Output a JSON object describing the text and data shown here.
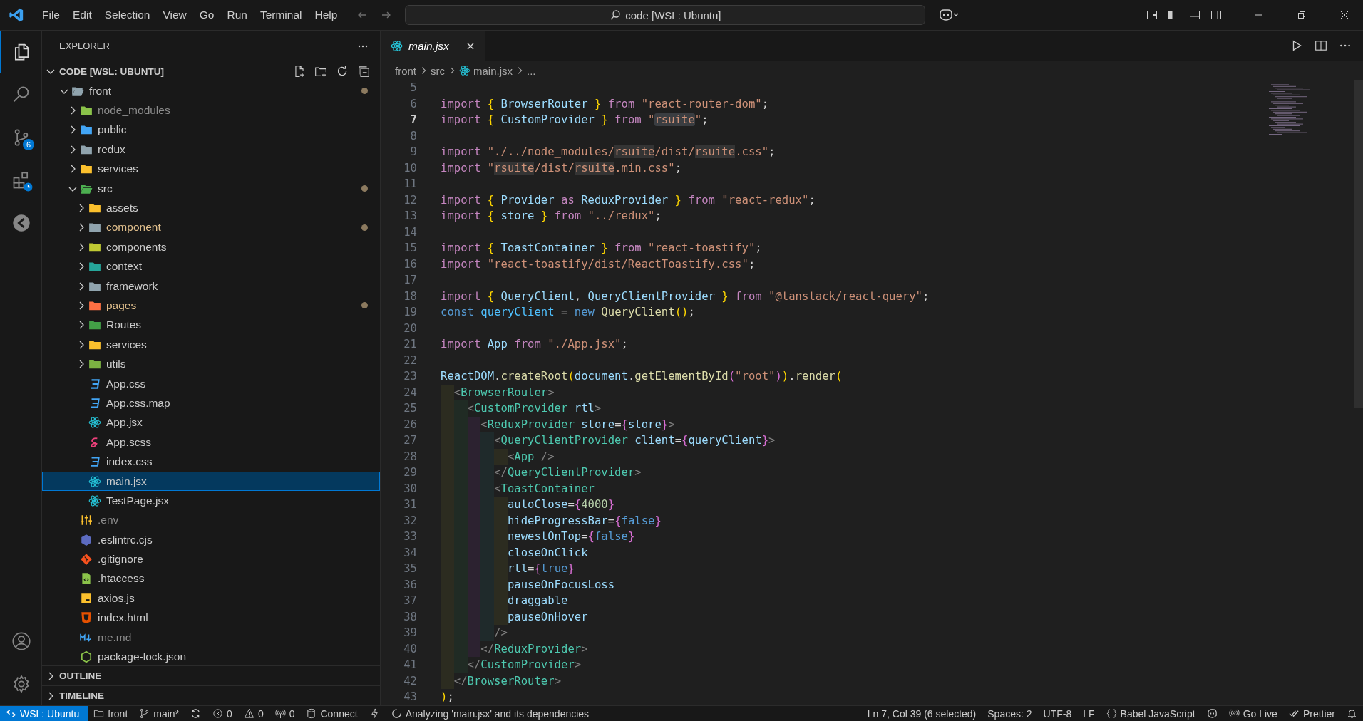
{
  "title_bar": {
    "menu": [
      "File",
      "Edit",
      "Selection",
      "View",
      "Go",
      "Run",
      "Terminal",
      "Help"
    ],
    "command_center": "code [WSL: Ubuntu]"
  },
  "activity_bar": {
    "items": [
      {
        "kind": "explorer",
        "selected": true
      },
      {
        "kind": "search",
        "selected": false
      },
      {
        "kind": "source-control",
        "selected": false,
        "badge": "6"
      },
      {
        "kind": "extensions",
        "selected": false
      },
      {
        "kind": "remote",
        "selected": false
      }
    ],
    "bottom": [
      {
        "kind": "account"
      },
      {
        "kind": "settings"
      }
    ]
  },
  "sidebar": {
    "title": "EXPLORER",
    "section": {
      "title": "CODE [WSL: UBUNTU]",
      "expanded": true
    },
    "tree": [
      {
        "name": "front",
        "kind": "folder",
        "color": "#90a4ae",
        "expanded": true,
        "selected": false,
        "has_changes": true,
        "children": [
          {
            "name": "node_modules",
            "kind": "folder",
            "color": "#8bc34a",
            "expanded": false,
            "selected": false,
            "ignored": true
          },
          {
            "name": "public",
            "kind": "folder",
            "color": "#42a5f5",
            "expanded": false,
            "selected": false
          },
          {
            "name": "redux",
            "kind": "folder",
            "color": "#90a4ae",
            "expanded": false,
            "selected": false
          },
          {
            "name": "services",
            "kind": "folder",
            "color": "#fbc02d",
            "expanded": false,
            "selected": false
          },
          {
            "name": "src",
            "kind": "folder",
            "color": "#4caf50",
            "expanded": true,
            "selected": false,
            "has_changes": true,
            "children": [
              {
                "name": "assets",
                "kind": "folder",
                "color": "#fbc02d",
                "expanded": false,
                "selected": false
              },
              {
                "name": "component",
                "kind": "folder",
                "color": "#90a4ae",
                "expanded": false,
                "selected": false,
                "has_changes": true,
                "modified": true
              },
              {
                "name": "components",
                "kind": "folder",
                "color": "#c0ca33",
                "expanded": false,
                "selected": false
              },
              {
                "name": "context",
                "kind": "folder",
                "color": "#26a69a",
                "expanded": false,
                "selected": false
              },
              {
                "name": "framework",
                "kind": "folder",
                "color": "#90a4ae",
                "expanded": false,
                "selected": false
              },
              {
                "name": "pages",
                "kind": "folder",
                "color": "#ff7043",
                "expanded": false,
                "selected": false,
                "has_changes": true,
                "modified": true
              },
              {
                "name": "Routes",
                "kind": "folder",
                "color": "#43a047",
                "expanded": false,
                "selected": false
              },
              {
                "name": "services",
                "kind": "folder",
                "color": "#fbc02d",
                "expanded": false,
                "selected": false
              },
              {
                "name": "utils",
                "kind": "folder",
                "color": "#7cb342",
                "expanded": false,
                "selected": false
              },
              {
                "name": "App.css",
                "kind": "css",
                "selected": false
              },
              {
                "name": "App.css.map",
                "kind": "css",
                "selected": false
              },
              {
                "name": "App.jsx",
                "kind": "react",
                "selected": false
              },
              {
                "name": "App.scss",
                "kind": "sass",
                "selected": false
              },
              {
                "name": "index.css",
                "kind": "css",
                "selected": false
              },
              {
                "name": "main.jsx",
                "kind": "react",
                "selected": true
              },
              {
                "name": "TestPage.jsx",
                "kind": "react",
                "selected": false
              }
            ]
          },
          {
            "name": ".env",
            "kind": "env",
            "selected": false,
            "ignored": true
          },
          {
            "name": ".eslintrc.cjs",
            "kind": "eslint",
            "selected": false
          },
          {
            "name": ".gitignore",
            "kind": "git",
            "selected": false
          },
          {
            "name": ".htaccess",
            "kind": "htaccess",
            "selected": false
          },
          {
            "name": "axios.js",
            "kind": "js",
            "selected": false
          },
          {
            "name": "index.html",
            "kind": "html",
            "selected": false
          },
          {
            "name": "me.md",
            "kind": "markdown",
            "selected": false,
            "ignored": true
          },
          {
            "name": "package-lock.json",
            "kind": "json",
            "selected": false
          }
        ]
      }
    ],
    "panels": [
      {
        "title": "OUTLINE",
        "expanded": false
      },
      {
        "title": "TIMELINE",
        "expanded": false
      }
    ]
  },
  "editor": {
    "tabs": [
      {
        "label": "main.jsx",
        "kind": "react",
        "selected": true,
        "preview": true
      }
    ],
    "breadcrumbs": [
      {
        "text": "front"
      },
      {
        "text": "src"
      },
      {
        "text": "main.jsx",
        "kind": "react"
      },
      {
        "text": "..."
      }
    ],
    "lines": [
      {
        "n": "5",
        "current": false
      },
      {
        "n": "6",
        "current": false,
        "tokens": [
          {
            "kind": "kw",
            "text": "import "
          },
          {
            "kind": "br",
            "text": "{ "
          },
          {
            "kind": "id",
            "text": "BrowserRouter "
          },
          {
            "kind": "br",
            "text": "} "
          },
          {
            "kind": "kw",
            "text": "from "
          },
          {
            "kind": "str",
            "text": "\"react-router-dom\""
          },
          {
            "kind": "pl",
            "text": ";"
          }
        ]
      },
      {
        "n": "7",
        "current": true,
        "tokens": [
          {
            "kind": "kw",
            "text": "import "
          },
          {
            "kind": "br",
            "text": "{ "
          },
          {
            "kind": "id",
            "text": "CustomProvider "
          },
          {
            "kind": "br",
            "text": "} "
          },
          {
            "kind": "kw",
            "text": "from "
          },
          {
            "kind": "str",
            "text": "\""
          },
          {
            "kind": "strsel",
            "text": "rsuite"
          },
          {
            "kind": "str",
            "text": "\""
          },
          {
            "kind": "pl",
            "text": ";"
          }
        ]
      },
      {
        "n": "8",
        "current": false
      },
      {
        "n": "9",
        "current": false,
        "tokens": [
          {
            "kind": "kw",
            "text": "import "
          },
          {
            "kind": "str",
            "text": "\"./../node_modules/"
          },
          {
            "kind": "strhl",
            "text": "rsuite"
          },
          {
            "kind": "str",
            "text": "/dist/"
          },
          {
            "kind": "strhl",
            "text": "rsuite"
          },
          {
            "kind": "str",
            "text": ".css\""
          },
          {
            "kind": "pl",
            "text": ";"
          }
        ]
      },
      {
        "n": "10",
        "current": false,
        "tokens": [
          {
            "kind": "kw",
            "text": "import "
          },
          {
            "kind": "str",
            "text": "\""
          },
          {
            "kind": "strhl",
            "text": "rsuite"
          },
          {
            "kind": "str",
            "text": "/dist/"
          },
          {
            "kind": "strhl",
            "text": "rsuite"
          },
          {
            "kind": "str",
            "text": ".min.css\""
          },
          {
            "kind": "pl",
            "text": ";"
          }
        ]
      },
      {
        "n": "11",
        "current": false
      },
      {
        "n": "12",
        "current": false,
        "tokens": [
          {
            "kind": "kw",
            "text": "import "
          },
          {
            "kind": "br",
            "text": "{ "
          },
          {
            "kind": "id",
            "text": "Provider "
          },
          {
            "kind": "kw",
            "text": "as "
          },
          {
            "kind": "id",
            "text": "ReduxProvider "
          },
          {
            "kind": "br",
            "text": "} "
          },
          {
            "kind": "kw",
            "text": "from "
          },
          {
            "kind": "str",
            "text": "\"react-redux\""
          },
          {
            "kind": "pl",
            "text": ";"
          }
        ]
      },
      {
        "n": "13",
        "current": false,
        "tokens": [
          {
            "kind": "kw",
            "text": "import "
          },
          {
            "kind": "br",
            "text": "{ "
          },
          {
            "kind": "id",
            "text": "store "
          },
          {
            "kind": "br",
            "text": "} "
          },
          {
            "kind": "kw",
            "text": "from "
          },
          {
            "kind": "str",
            "text": "\"../redux\""
          },
          {
            "kind": "pl",
            "text": ";"
          }
        ]
      },
      {
        "n": "14",
        "current": false
      },
      {
        "n": "15",
        "current": false,
        "tokens": [
          {
            "kind": "kw",
            "text": "import "
          },
          {
            "kind": "br",
            "text": "{ "
          },
          {
            "kind": "id",
            "text": "ToastContainer "
          },
          {
            "kind": "br",
            "text": "} "
          },
          {
            "kind": "kw",
            "text": "from "
          },
          {
            "kind": "str",
            "text": "\"react-toastify\""
          },
          {
            "kind": "pl",
            "text": ";"
          }
        ]
      },
      {
        "n": "16",
        "current": false,
        "tokens": [
          {
            "kind": "kw",
            "text": "import "
          },
          {
            "kind": "str",
            "text": "\"react-toastify/dist/ReactToastify.css\""
          },
          {
            "kind": "pl",
            "text": ";"
          }
        ]
      },
      {
        "n": "17",
        "current": false
      },
      {
        "n": "18",
        "current": false,
        "tokens": [
          {
            "kind": "kw",
            "text": "import "
          },
          {
            "kind": "br",
            "text": "{ "
          },
          {
            "kind": "id",
            "text": "QueryClient"
          },
          {
            "kind": "pl",
            "text": ", "
          },
          {
            "kind": "id",
            "text": "QueryClientProvider "
          },
          {
            "kind": "br",
            "text": "} "
          },
          {
            "kind": "kw",
            "text": "from "
          },
          {
            "kind": "str",
            "text": "\"@tanstack/react-query\""
          },
          {
            "kind": "pl",
            "text": ";"
          }
        ]
      },
      {
        "n": "19",
        "current": false,
        "tokens": [
          {
            "kind": "decl",
            "text": "const "
          },
          {
            "kind": "var",
            "text": "queryClient "
          },
          {
            "kind": "pl",
            "text": "= "
          },
          {
            "kind": "decl",
            "text": "new "
          },
          {
            "kind": "fn",
            "text": "QueryClient"
          },
          {
            "kind": "br",
            "text": "()"
          },
          {
            "kind": "pl",
            "text": ";"
          }
        ]
      },
      {
        "n": "20",
        "current": false
      },
      {
        "n": "21",
        "current": false,
        "tokens": [
          {
            "kind": "kw",
            "text": "import "
          },
          {
            "kind": "id",
            "text": "App "
          },
          {
            "kind": "kw",
            "text": "from "
          },
          {
            "kind": "str",
            "text": "\"./App.jsx\""
          },
          {
            "kind": "pl",
            "text": ";"
          }
        ]
      },
      {
        "n": "22",
        "current": false
      },
      {
        "n": "23",
        "current": false,
        "tokens": [
          {
            "kind": "id",
            "text": "ReactDOM"
          },
          {
            "kind": "pl",
            "text": "."
          },
          {
            "kind": "fn",
            "text": "createRoot"
          },
          {
            "kind": "br",
            "text": "("
          },
          {
            "kind": "id",
            "text": "document"
          },
          {
            "kind": "pl",
            "text": "."
          },
          {
            "kind": "fn",
            "text": "getElementById"
          },
          {
            "kind": "br2",
            "text": "("
          },
          {
            "kind": "str",
            "text": "\"root\""
          },
          {
            "kind": "br2",
            "text": ")"
          },
          {
            "kind": "br",
            "text": ")"
          },
          {
            "kind": "pl",
            "text": "."
          },
          {
            "kind": "fn",
            "text": "render"
          },
          {
            "kind": "br",
            "text": "("
          }
        ]
      },
      {
        "n": "24",
        "current": false,
        "tokens": [
          {
            "kind": "tp",
            "text": "  <"
          },
          {
            "kind": "tag",
            "text": "BrowserRouter"
          },
          {
            "kind": "tp",
            "text": ">"
          }
        ]
      },
      {
        "n": "25",
        "current": false,
        "tokens": [
          {
            "kind": "tp",
            "text": "    <"
          },
          {
            "kind": "tag",
            "text": "CustomProvider "
          },
          {
            "kind": "attr",
            "text": "rtl"
          },
          {
            "kind": "tp",
            "text": ">"
          }
        ]
      },
      {
        "n": "26",
        "current": false,
        "tokens": [
          {
            "kind": "tp",
            "text": "      <"
          },
          {
            "kind": "tag",
            "text": "ReduxProvider "
          },
          {
            "kind": "attr",
            "text": "store"
          },
          {
            "kind": "pl",
            "text": "="
          },
          {
            "kind": "br2",
            "text": "{"
          },
          {
            "kind": "attr",
            "text": "store"
          },
          {
            "kind": "br2",
            "text": "}"
          },
          {
            "kind": "tp",
            "text": ">"
          }
        ]
      },
      {
        "n": "27",
        "current": false,
        "tokens": [
          {
            "kind": "tp",
            "text": "        <"
          },
          {
            "kind": "tag",
            "text": "QueryClientProvider "
          },
          {
            "kind": "attr",
            "text": "client"
          },
          {
            "kind": "pl",
            "text": "="
          },
          {
            "kind": "br2",
            "text": "{"
          },
          {
            "kind": "attr",
            "text": "queryClient"
          },
          {
            "kind": "br2",
            "text": "}"
          },
          {
            "kind": "tp",
            "text": ">"
          }
        ]
      },
      {
        "n": "28",
        "current": false,
        "tokens": [
          {
            "kind": "tp",
            "text": "          <"
          },
          {
            "kind": "tag",
            "text": "App "
          },
          {
            "kind": "tp",
            "text": "/>"
          }
        ]
      },
      {
        "n": "29",
        "current": false,
        "tokens": [
          {
            "kind": "tp",
            "text": "        </"
          },
          {
            "kind": "tag",
            "text": "QueryClientProvider"
          },
          {
            "kind": "tp",
            "text": ">"
          }
        ]
      },
      {
        "n": "30",
        "current": false,
        "tokens": [
          {
            "kind": "tp",
            "text": "        <"
          },
          {
            "kind": "tag",
            "text": "ToastContainer"
          }
        ]
      },
      {
        "n": "31",
        "current": false,
        "tokens": [
          {
            "kind": "attr",
            "text": "          autoClose"
          },
          {
            "kind": "pl",
            "text": "="
          },
          {
            "kind": "br2",
            "text": "{"
          },
          {
            "kind": "num",
            "text": "4000"
          },
          {
            "kind": "br2",
            "text": "}"
          }
        ]
      },
      {
        "n": "32",
        "current": false,
        "tokens": [
          {
            "kind": "attr",
            "text": "          hideProgressBar"
          },
          {
            "kind": "pl",
            "text": "="
          },
          {
            "kind": "br2",
            "text": "{"
          },
          {
            "kind": "decl",
            "text": "false"
          },
          {
            "kind": "br2",
            "text": "}"
          }
        ]
      },
      {
        "n": "33",
        "current": false,
        "tokens": [
          {
            "kind": "attr",
            "text": "          newestOnTop"
          },
          {
            "kind": "pl",
            "text": "="
          },
          {
            "kind": "br2",
            "text": "{"
          },
          {
            "kind": "decl",
            "text": "false"
          },
          {
            "kind": "br2",
            "text": "}"
          }
        ]
      },
      {
        "n": "34",
        "current": false,
        "tokens": [
          {
            "kind": "attr",
            "text": "          closeOnClick"
          }
        ]
      },
      {
        "n": "35",
        "current": false,
        "tokens": [
          {
            "kind": "attr",
            "text": "          rtl"
          },
          {
            "kind": "pl",
            "text": "="
          },
          {
            "kind": "br2",
            "text": "{"
          },
          {
            "kind": "decl",
            "text": "true"
          },
          {
            "kind": "br2",
            "text": "}"
          }
        ]
      },
      {
        "n": "36",
        "current": false,
        "tokens": [
          {
            "kind": "attr",
            "text": "          pauseOnFocusLoss"
          }
        ]
      },
      {
        "n": "37",
        "current": false,
        "tokens": [
          {
            "kind": "attr",
            "text": "          draggable"
          }
        ]
      },
      {
        "n": "38",
        "current": false,
        "tokens": [
          {
            "kind": "attr",
            "text": "          pauseOnHover"
          }
        ]
      },
      {
        "n": "39",
        "current": false,
        "tokens": [
          {
            "kind": "tp",
            "text": "        />"
          }
        ]
      },
      {
        "n": "40",
        "current": false,
        "tokens": [
          {
            "kind": "tp",
            "text": "      </"
          },
          {
            "kind": "tag",
            "text": "ReduxProvider"
          },
          {
            "kind": "tp",
            "text": ">"
          }
        ]
      },
      {
        "n": "41",
        "current": false,
        "tokens": [
          {
            "kind": "tp",
            "text": "    </"
          },
          {
            "kind": "tag",
            "text": "CustomProvider"
          },
          {
            "kind": "tp",
            "text": ">"
          }
        ]
      },
      {
        "n": "42",
        "current": false,
        "tokens": [
          {
            "kind": "tp",
            "text": "  </"
          },
          {
            "kind": "tag",
            "text": "BrowserRouter"
          },
          {
            "kind": "tp",
            "text": ">"
          }
        ]
      },
      {
        "n": "43",
        "current": false,
        "tokens": [
          {
            "kind": "br",
            "text": ")"
          },
          {
            "kind": "pl",
            "text": ";"
          }
        ]
      }
    ]
  },
  "status_bar": {
    "left": [
      {
        "kind": "remote",
        "text": "WSL: Ubuntu"
      },
      {
        "kind": "folder",
        "text": "front"
      },
      {
        "kind": "branch",
        "text": "main*"
      },
      {
        "kind": "sync"
      },
      {
        "kind": "errors",
        "text": "0"
      },
      {
        "kind": "warnings",
        "text": "0"
      },
      {
        "kind": "ports",
        "text": "0"
      },
      {
        "kind": "database",
        "text": "Connect"
      },
      {
        "kind": "lightning"
      },
      {
        "kind": "progress",
        "text": "Analyzing 'main.jsx' and its dependencies"
      }
    ],
    "right": [
      {
        "kind": "text",
        "text": "Ln 7, Col 39 (6 selected)"
      },
      {
        "kind": "text",
        "text": "Spaces: 2"
      },
      {
        "kind": "text",
        "text": "UTF-8"
      },
      {
        "kind": "text",
        "text": "LF"
      },
      {
        "kind": "language",
        "text": "Babel JavaScript"
      },
      {
        "kind": "copilot"
      },
      {
        "kind": "live",
        "text": "Go Live"
      },
      {
        "kind": "prettier",
        "text": "Prettier"
      },
      {
        "kind": "bell"
      }
    ]
  }
}
